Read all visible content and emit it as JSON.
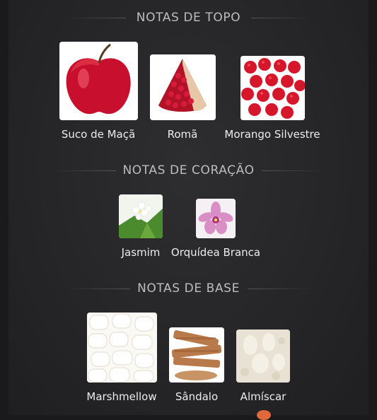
{
  "sections": [
    {
      "title": "NOTAS DE TOPO",
      "notes": [
        {
          "label": "Suco de Maçã",
          "icon": "apple-image"
        },
        {
          "label": "Romã",
          "icon": "pomegranate-image"
        },
        {
          "label": "Morango Silvestre",
          "icon": "wild-strawberry-image"
        }
      ]
    },
    {
      "title": "NOTAS DE CORAÇÃO",
      "notes": [
        {
          "label": "Jasmim",
          "icon": "jasmine-image"
        },
        {
          "label": "Orquídea Branca",
          "icon": "orchid-image"
        }
      ]
    },
    {
      "title": "NOTAS DE BASE",
      "notes": [
        {
          "label": "Marshmellow",
          "icon": "marshmallow-image"
        },
        {
          "label": "Sândalo",
          "icon": "sandalwood-image"
        },
        {
          "label": "Almíscar",
          "icon": "musk-image"
        }
      ]
    }
  ],
  "colors": {
    "background": "#1a1a1c",
    "panel": "#262628",
    "title_text": "#bdbdbd",
    "label_text": "#ececec",
    "accent": "#e0683a"
  }
}
